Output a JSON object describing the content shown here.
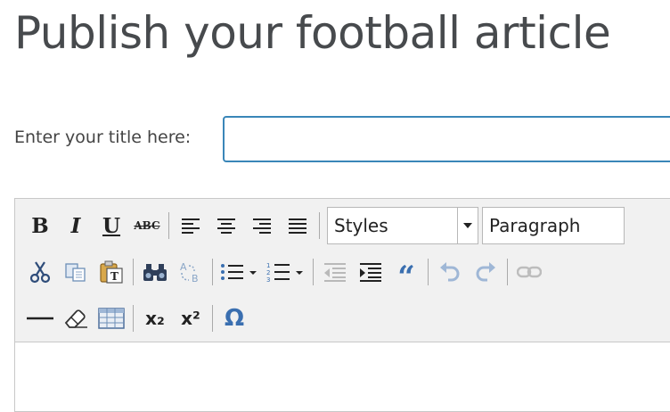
{
  "page": {
    "title": "Publish your football article"
  },
  "form": {
    "title_label": "Enter your title here:",
    "title_value": "",
    "title_placeholder": ""
  },
  "toolbar": {
    "styles_value": "Styles",
    "format_value": "Paragraph",
    "bold_label": "B",
    "italic_label": "I",
    "underline_label": "U",
    "strike_label": "ABC",
    "blockquote_label": "“",
    "subscript_label": "x₂",
    "superscript_label": "x²",
    "special_char_label": "Ω",
    "icons": [
      "bold-icon",
      "italic-icon",
      "underline-icon",
      "strikethrough-icon",
      "align-left-icon",
      "align-center-icon",
      "align-right-icon",
      "align-justify-icon",
      "cut-icon",
      "copy-icon",
      "paste-text-icon",
      "find-icon",
      "replace-icon",
      "bulleted-list-icon",
      "numbered-list-icon",
      "outdent-icon",
      "indent-icon",
      "blockquote-icon",
      "undo-icon",
      "redo-icon",
      "link-icon",
      "horizontal-rule-icon",
      "eraser-icon",
      "table-icon",
      "subscript-icon",
      "superscript-icon",
      "special-character-icon"
    ],
    "colors": {
      "toolbar_bg": "#f1f1f1",
      "input_border": "#3a86b8",
      "accent_blue": "#3a6fb0"
    }
  },
  "editor": {
    "content": ""
  }
}
